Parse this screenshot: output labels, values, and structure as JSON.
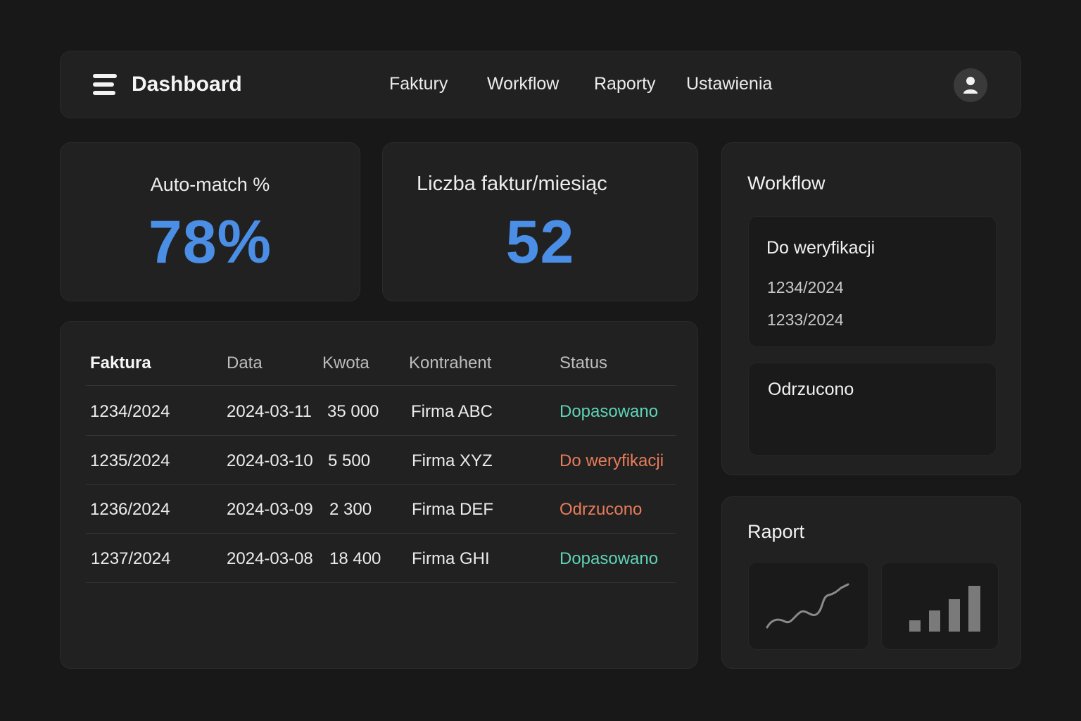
{
  "header": {
    "title": "Dashboard",
    "nav": [
      "Faktury",
      "Workflow",
      "Raporty",
      "Ustawienia"
    ]
  },
  "kpis": [
    {
      "label": "Auto-match %",
      "value": "78%"
    },
    {
      "label": "Liczba faktur/miesiąc",
      "value": "52"
    }
  ],
  "table": {
    "columns": [
      "Faktura",
      "Data",
      "Kwota",
      "Kontrahent",
      "Status"
    ],
    "rows": [
      {
        "invoice": "1234/2024",
        "date": "2024-03-11",
        "amount": "35 000",
        "contractor": "Firma ABC",
        "status": "Dopasowano",
        "status_color": "#5ed3b5"
      },
      {
        "invoice": "1235/2024",
        "date": "2024-03-10",
        "amount": "5 500",
        "contractor": "Firma XYZ",
        "status": "Do weryfikacji",
        "status_color": "#e87c5a"
      },
      {
        "invoice": "1236/2024",
        "date": "2024-03-09",
        "amount": "2 300",
        "contractor": "Firma DEF",
        "status": "Odrzucono",
        "status_color": "#e87c5a"
      },
      {
        "invoice": "1237/2024",
        "date": "2024-03-08",
        "amount": "18 400",
        "contractor": "Firma GHI",
        "status": "Dopasowano",
        "status_color": "#5ed3b5"
      }
    ]
  },
  "workflow": {
    "title": "Workflow",
    "groups": [
      {
        "title": "Do weryfikacji",
        "items": [
          "1234/2024",
          "1233/2024"
        ]
      },
      {
        "title": "Odrzucono",
        "items": []
      }
    ]
  },
  "report": {
    "title": "Raport",
    "line_icon": "line-chart-icon",
    "bar_icon": "bar-chart-icon"
  },
  "colors": {
    "accent": "#4a8ee6",
    "matched": "#5ed3b5",
    "warning": "#e87c5a"
  }
}
